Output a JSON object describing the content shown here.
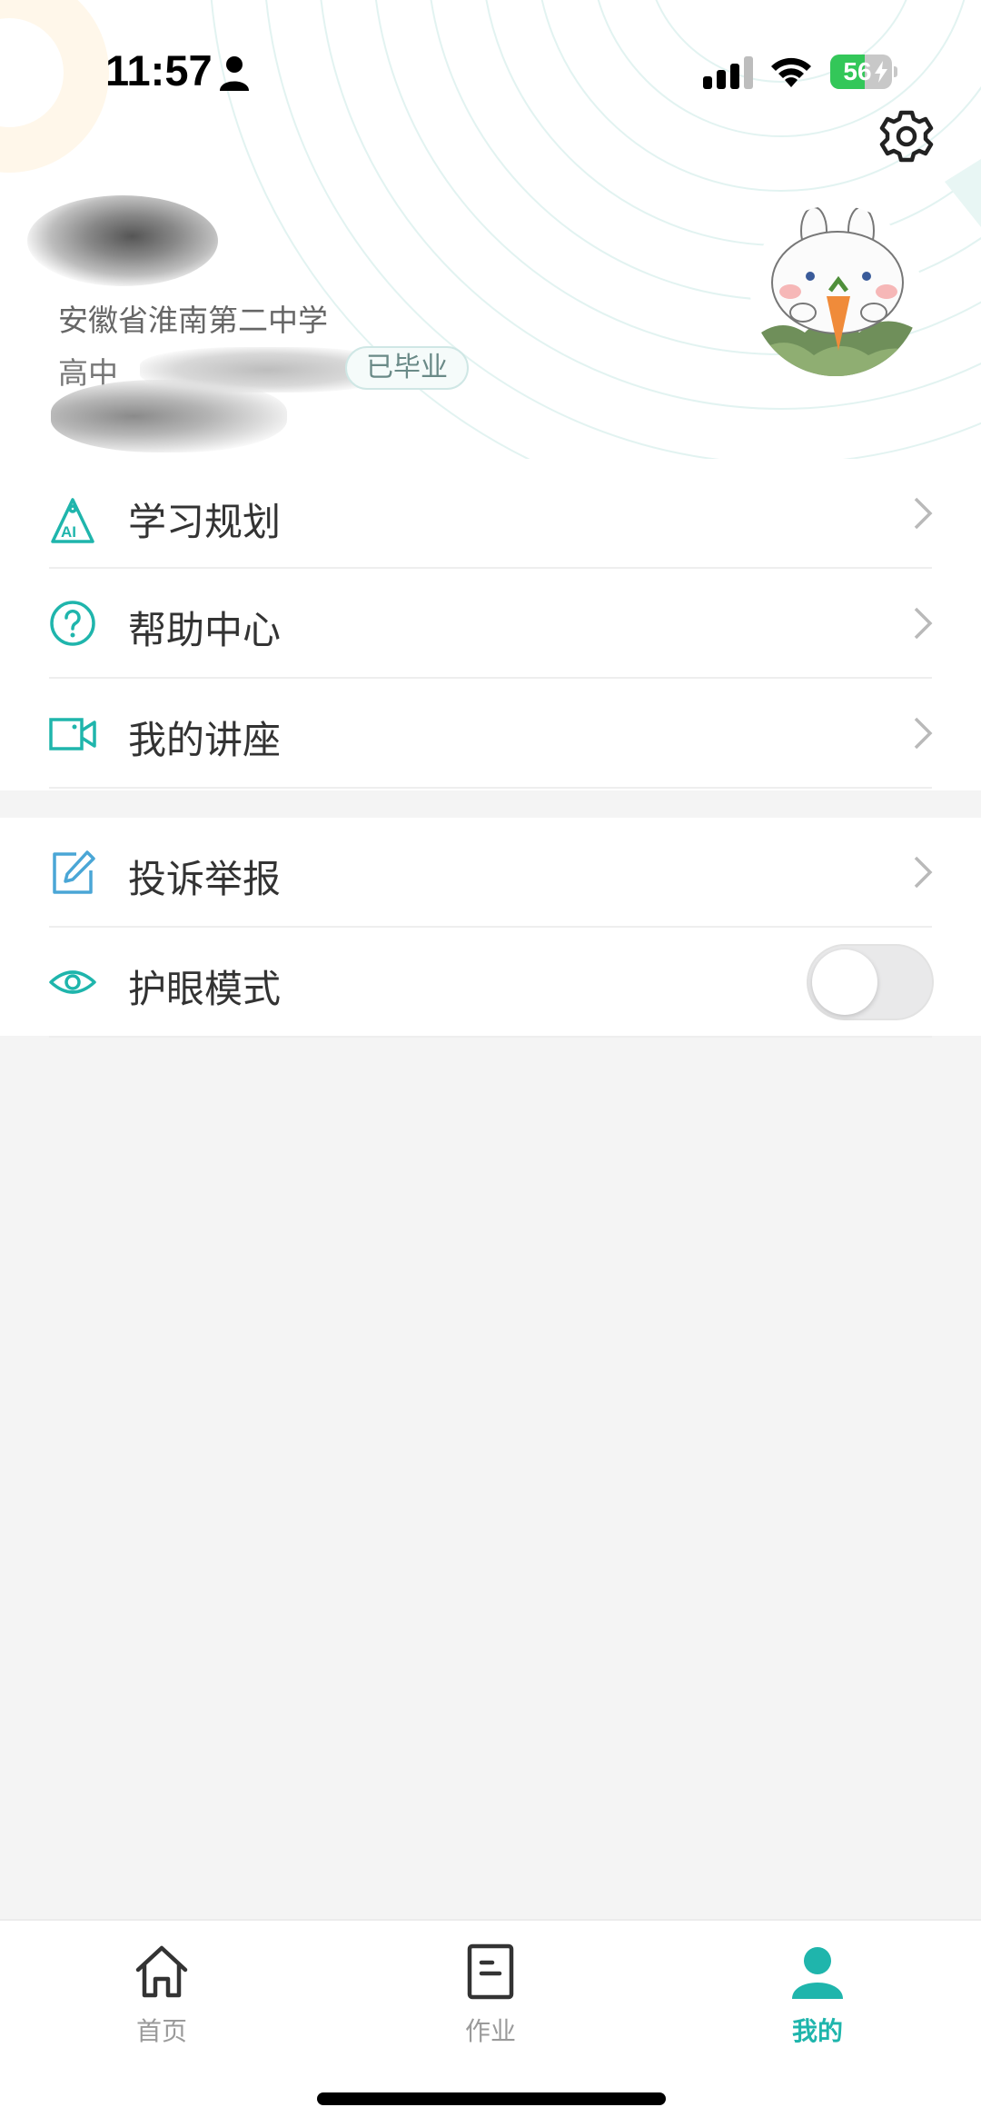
{
  "status_bar": {
    "time": "11:57",
    "battery_level": "56",
    "battery_fraction": 0.56
  },
  "profile": {
    "school": "安徽省淮南第二中学",
    "class_prefix": "高中",
    "graduated_badge": "已毕业",
    "student_id_prefix": "学号"
  },
  "menu_group_1": [
    {
      "label": "学习规划",
      "icon": "ai-study-plan-icon"
    },
    {
      "label": "帮助中心",
      "icon": "help-circle-icon"
    },
    {
      "label": "我的讲座",
      "icon": "video-camera-icon"
    }
  ],
  "menu_group_2": [
    {
      "label": "投诉举报",
      "icon": "edit-report-icon"
    },
    {
      "label": "护眼模式",
      "icon": "eye-icon",
      "toggle_on": false
    }
  ],
  "tabs": [
    {
      "label": "首页",
      "icon": "home-icon",
      "active": false
    },
    {
      "label": "作业",
      "icon": "homework-icon",
      "active": false
    },
    {
      "label": "我的",
      "icon": "profile-icon",
      "active": true
    }
  ],
  "colors": {
    "accent": "#1fb5ac",
    "text": "#333333",
    "background": "#f4f4f4"
  }
}
